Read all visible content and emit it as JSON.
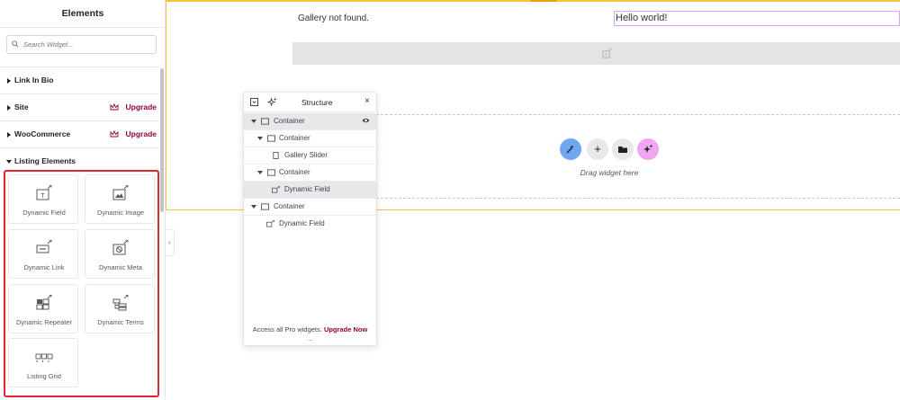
{
  "sidebar": {
    "title": "Elements",
    "search_placeholder": "Search Widget...",
    "categories": [
      {
        "label": "Link In Bio",
        "upgrade": ""
      },
      {
        "label": "Site",
        "upgrade": "Upgrade"
      },
      {
        "label": "WooCommerce",
        "upgrade": "Upgrade"
      },
      {
        "label": "Listing Elements",
        "upgrade": ""
      }
    ],
    "widgets": [
      {
        "label": "Dynamic Field",
        "icon": "dynamic-field-icon"
      },
      {
        "label": "Dynamic Image",
        "icon": "dynamic-image-icon"
      },
      {
        "label": "Dynamic Link",
        "icon": "dynamic-link-icon"
      },
      {
        "label": "Dynamic Meta",
        "icon": "dynamic-meta-icon"
      },
      {
        "label": "Dynamic Repeater",
        "icon": "dynamic-repeater-icon"
      },
      {
        "label": "Dynamic Terms",
        "icon": "dynamic-terms-icon"
      },
      {
        "label": "Listing Grid",
        "icon": "listing-grid-icon"
      }
    ],
    "collapse_glyph": "‹"
  },
  "canvas": {
    "gallery_message": "Gallery not found.",
    "hello_text": "Hello world!",
    "drag_text": "Drag widget here",
    "add_glyph": "+"
  },
  "structure": {
    "title": "Structure",
    "close_glyph": "×",
    "rows": [
      {
        "label": "Container"
      },
      {
        "label": "Container"
      },
      {
        "label": "Gallery Slider"
      },
      {
        "label": "Container"
      },
      {
        "label": "Dynamic Field"
      },
      {
        "label": "Container"
      },
      {
        "label": "Dynamic Field"
      }
    ],
    "footer_text": "Access all Pro widgets.",
    "footer_link": "Upgrade Now",
    "handle": "..."
  },
  "colors": {
    "accent_upgrade": "#93003f",
    "highlight_red": "#e3262d",
    "section_border": "#f5c342",
    "btn_blue": "#6fa8ef",
    "btn_gray": "#e6e8ea",
    "btn_pink": "#f0a6f0"
  }
}
